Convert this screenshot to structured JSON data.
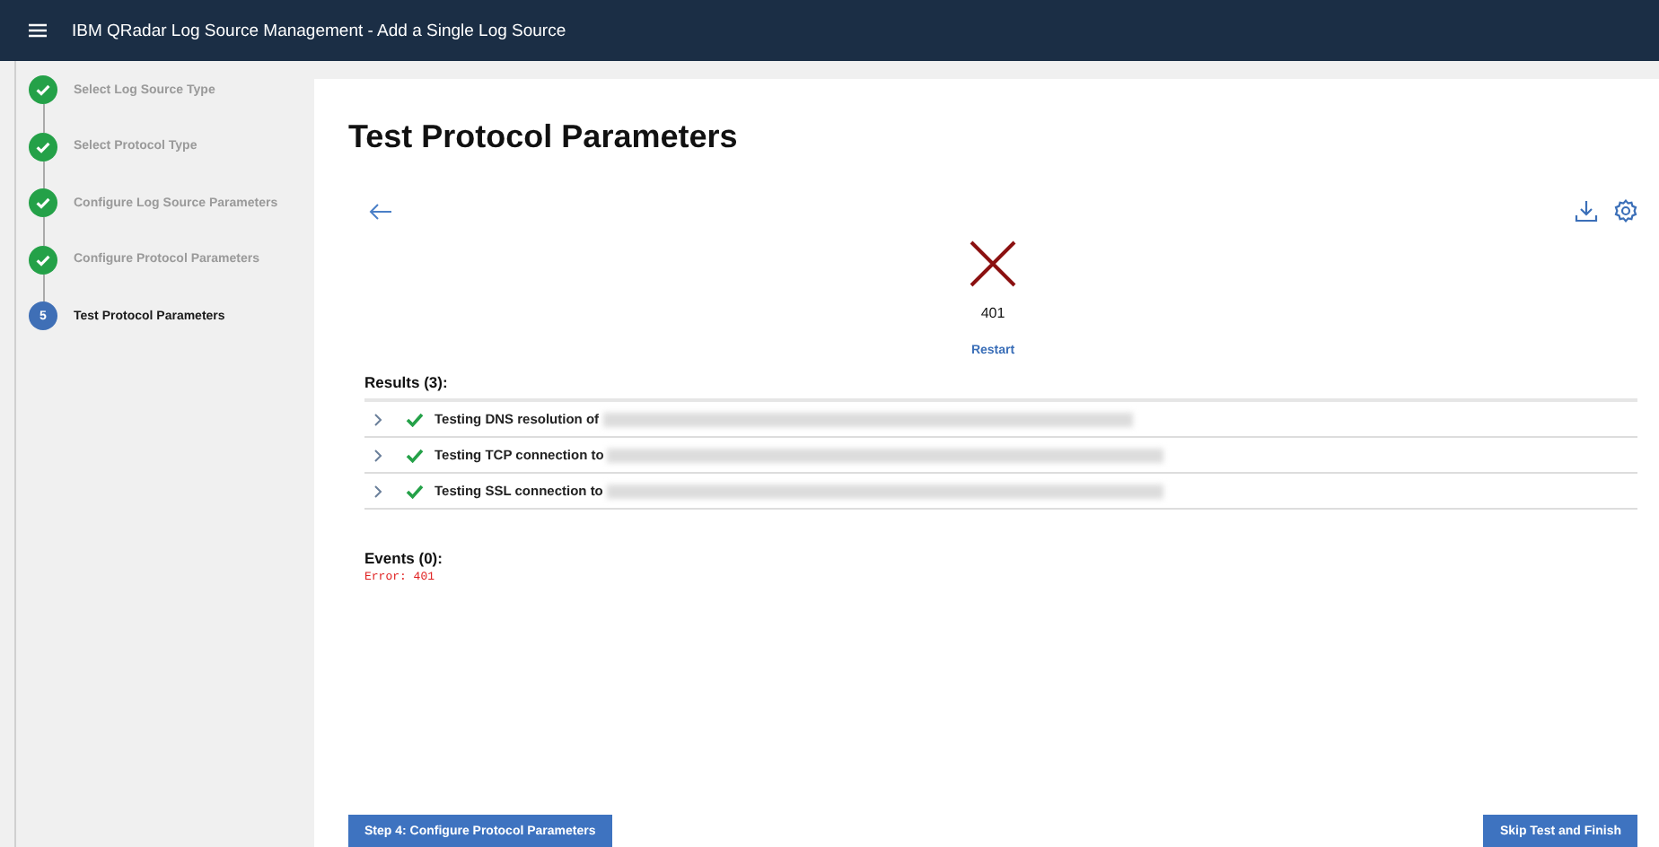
{
  "window": {
    "title": "IBM QRadar Log Source Management - Add a Single Log Source"
  },
  "steps": [
    {
      "label": "Select Log Source Type",
      "kind": "complete"
    },
    {
      "label": "Select Protocol Type",
      "kind": "complete"
    },
    {
      "label": "Configure Log Source Parameters",
      "kind": "complete"
    },
    {
      "label": "Configure Protocol Parameters",
      "kind": "complete"
    },
    {
      "label": "Test Protocol Parameters",
      "kind": "current",
      "number": "5"
    }
  ],
  "page": {
    "title": "Test Protocol Parameters",
    "status_code": "401",
    "restart": "Restart"
  },
  "results": {
    "heading": "Results (3):",
    "rows": [
      {
        "label": "Testing DNS resolution of",
        "kind": "passed",
        "expanded": false
      },
      {
        "label": "Testing TCP connection to",
        "kind": "passed",
        "expanded": false
      },
      {
        "label": "Testing SSL connection to",
        "kind": "passed",
        "expanded": false
      }
    ]
  },
  "events": {
    "heading": "Events (0):",
    "error": "Error: 401"
  },
  "buttons": {
    "back": "Step 4: Configure Protocol Parameters",
    "skip": "Skip Test and Finish"
  }
}
